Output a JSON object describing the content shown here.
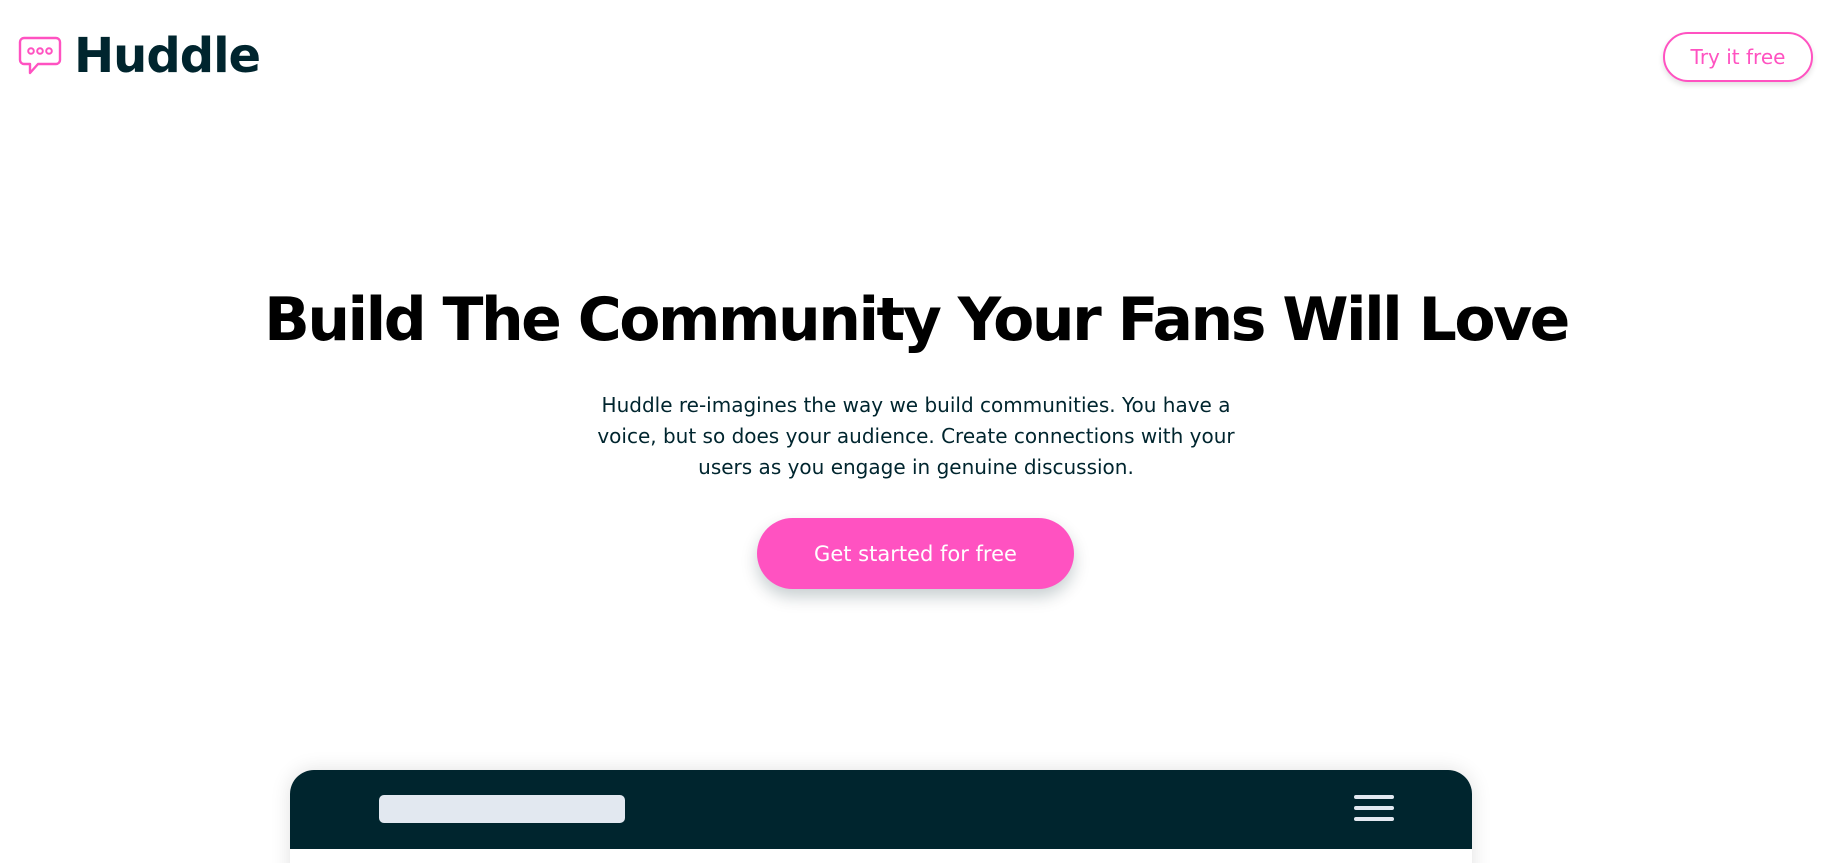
{
  "header": {
    "logo_text": "Huddle",
    "logo_icon": "chat-bubble-icon",
    "try_button_label": "Try it free"
  },
  "hero": {
    "title": "Build The Community Your Fans Will Love",
    "description": "Huddle re-imagines the way we build communities. You have a voice, but so does your audience. Create connections with your users as you engage in genuine discussion.",
    "cta_label": "Get started for free"
  },
  "mockup": {
    "menu_icon": "hamburger-menu-icon"
  },
  "colors": {
    "accent_pink": "#ff52c1",
    "dark_navy": "#00252e",
    "light_gray": "#e2e8f0",
    "background": "#ffffff"
  }
}
